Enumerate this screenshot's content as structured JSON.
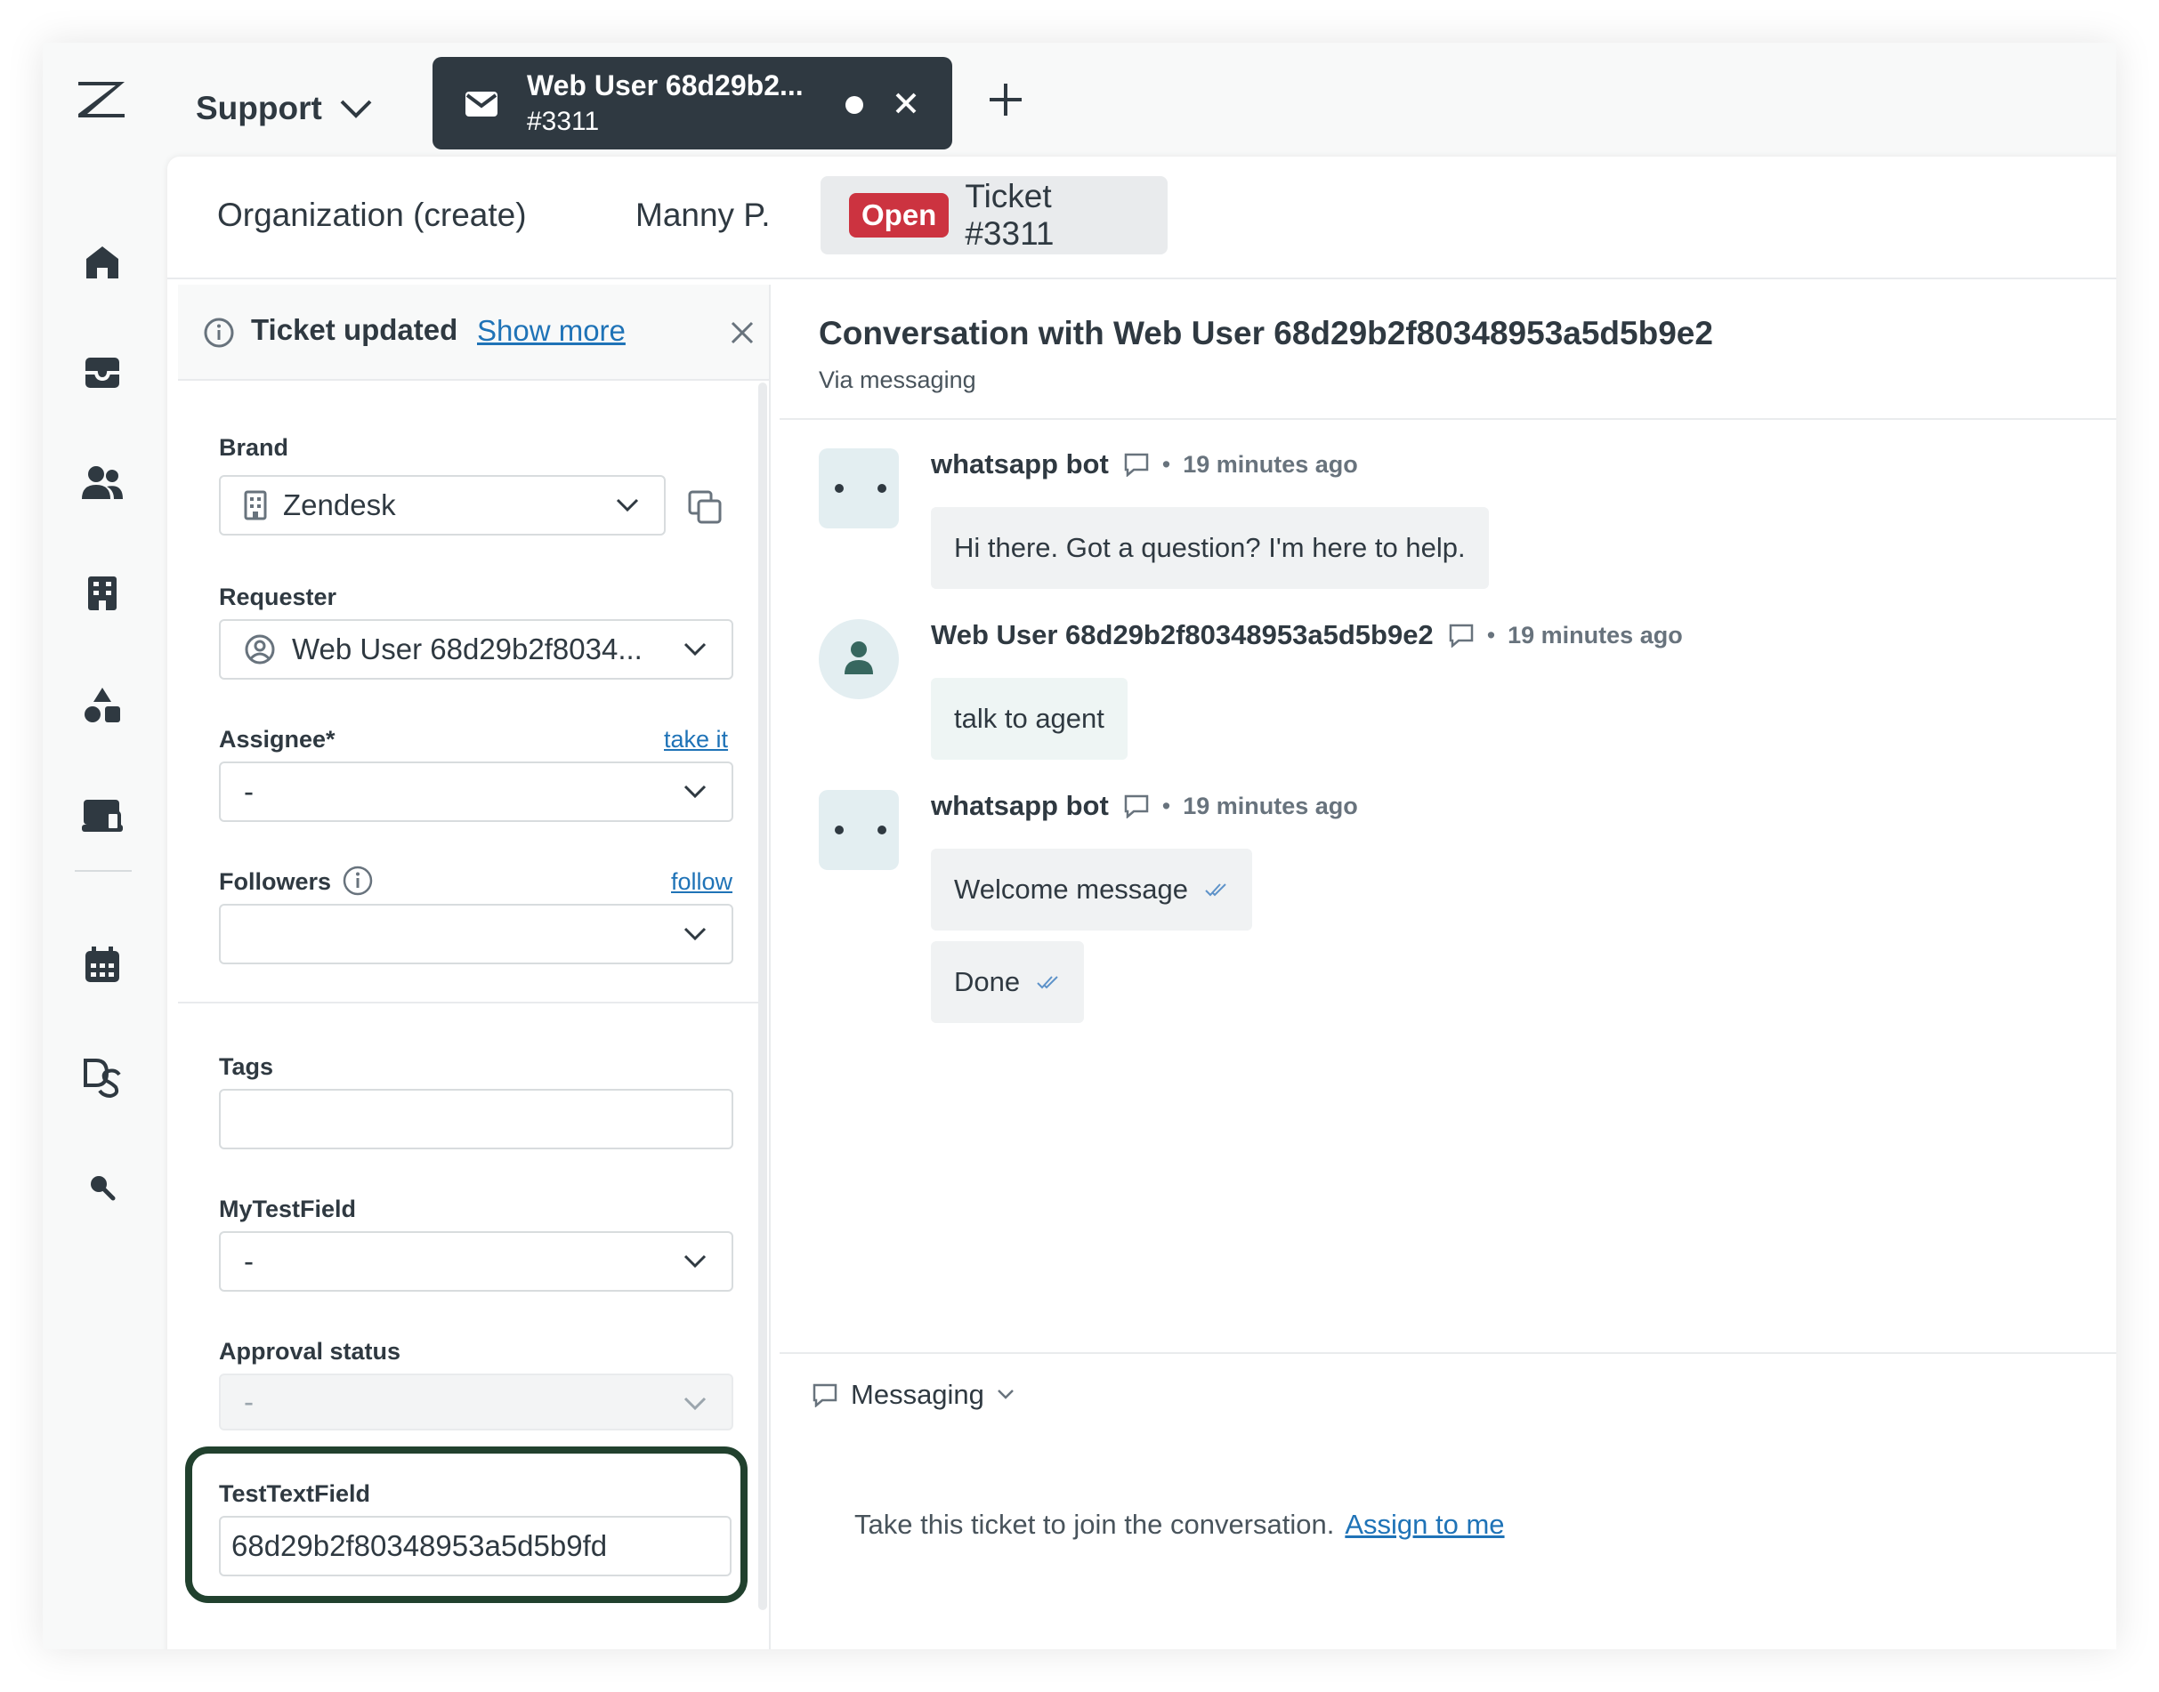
{
  "topbar": {
    "product": "Support",
    "active_tab": {
      "title": "Web User 68d29b2...",
      "ticket": "#3311"
    }
  },
  "subtabs": {
    "organization": "Organization (create)",
    "user": "Manny P.",
    "ticket_status": "Open",
    "ticket_title": "Ticket #3311"
  },
  "notice": {
    "title": "Ticket updated",
    "link": "Show more"
  },
  "fields": {
    "brand": {
      "label": "Brand",
      "value": "Zendesk"
    },
    "requester": {
      "label": "Requester",
      "value": "Web User 68d29b2f8034..."
    },
    "assignee": {
      "label": "Assignee*",
      "value": "-",
      "action": "take it"
    },
    "followers": {
      "label": "Followers",
      "value": "",
      "action": "follow"
    },
    "tags": {
      "label": "Tags",
      "value": ""
    },
    "mytestfield": {
      "label": "MyTestField",
      "value": "-"
    },
    "approval": {
      "label": "Approval status",
      "value": "-"
    },
    "testtextfield": {
      "label": "TestTextField",
      "value": "68d29b2f80348953a5d5b9fd"
    }
  },
  "conversation": {
    "title": "Conversation with Web User 68d29b2f80348953a5d5b9e2",
    "subtitle": "Via messaging",
    "messages": [
      {
        "author": "whatsapp bot",
        "time": "19 minutes ago",
        "text": "Hi there. Got a question? I'm here to help."
      },
      {
        "author": "Web User 68d29b2f80348953a5d5b9e2",
        "time": "19 minutes ago",
        "text": "talk to agent"
      },
      {
        "author": "whatsapp bot",
        "time": "19 minutes ago",
        "texts": [
          "Welcome message",
          "Done"
        ]
      }
    ]
  },
  "composer": {
    "channel": "Messaging",
    "note": "Take this ticket to join the conversation.",
    "link": "Assign to me"
  },
  "colors": {
    "dark": "#2f3941",
    "open_badge": "#cc3340",
    "link": "#1f73b7",
    "highlight_border": "#21412e"
  }
}
